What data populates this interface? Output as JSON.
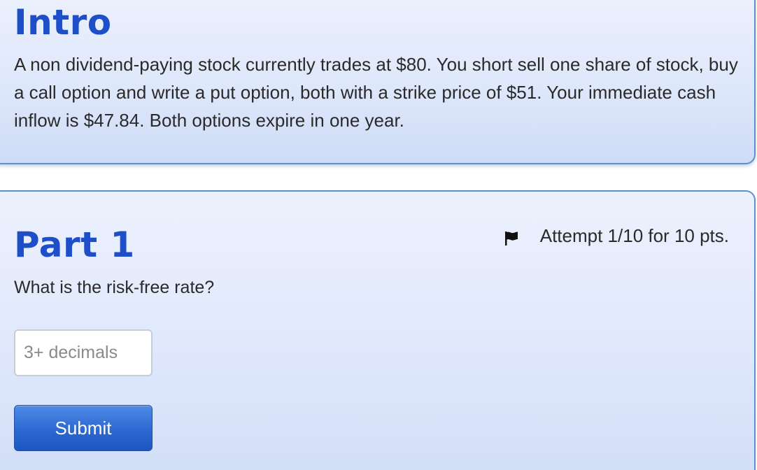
{
  "intro": {
    "title": "Intro",
    "text": "A non dividend-paying stock currently trades at $80. You short sell one share of stock, buy a call option and write a put option, both with a strike price of $51. Your immediate cash inflow is $47.84. Both options expire in one year."
  },
  "part1": {
    "title": "Part 1",
    "flag_icon": "flag-icon",
    "attempt_text": "Attempt 1/10 for 10 pts.",
    "question": "What is the risk-free rate?",
    "input_value": "",
    "input_placeholder": "3+ decimals",
    "submit_label": "Submit"
  },
  "colors": {
    "heading": "#1e4fc9",
    "card_border": "#5b8fd0",
    "button": "#2b68d2"
  }
}
